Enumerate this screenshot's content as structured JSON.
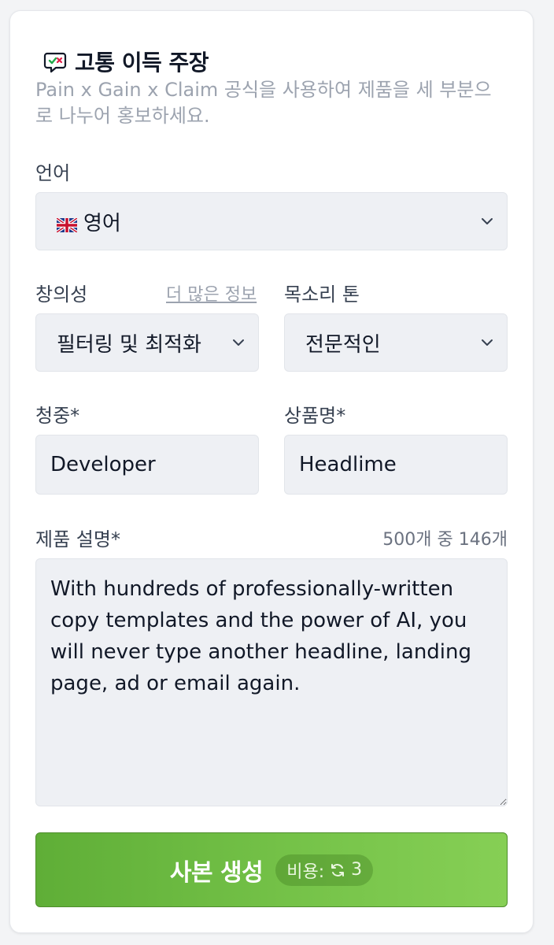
{
  "header": {
    "title": "고통 이득 주장",
    "icon": "chat-check-x-icon",
    "description": "Pain x Gain x Claim 공식을 사용하여 제품을 세 부분으로 나누어 홍보하세요."
  },
  "language": {
    "label": "언어",
    "value": "영어",
    "flag": "uk-flag-icon"
  },
  "creativity": {
    "label": "창의성",
    "more_info": "더 많은 정보",
    "value": "필터링 및 최적화"
  },
  "tone": {
    "label": "목소리 톤",
    "value": "전문적인"
  },
  "audience": {
    "label": "청중*",
    "value": "Developer"
  },
  "product_name": {
    "label": "상품명*",
    "value": "Headlime"
  },
  "product_description": {
    "label": "제품 설명*",
    "counter": "500개 중 146개",
    "value": "With hundreds of professionally-written copy templates and the power of AI, you will never type another headline, landing page, ad or email again."
  },
  "generate": {
    "label": "사본 생성",
    "cost_label": "비용:",
    "cost_value": "3",
    "cost_icon": "refresh-credit-icon"
  },
  "colors": {
    "button_green": "#6cbb42",
    "field_bg": "#eef0f4",
    "muted_text": "#9ca3af"
  }
}
